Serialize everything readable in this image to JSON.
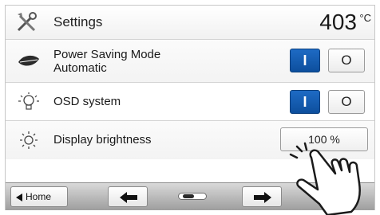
{
  "header": {
    "title": "Settings",
    "temperature": "403",
    "unit": "°C",
    "icon": "settings-tools-icon"
  },
  "rows": [
    {
      "id": "power-saving",
      "icon": "leaf-icon",
      "label_line1": "Power Saving Mode",
      "label_line2": "Automatic",
      "on_label": "I",
      "off_label": "O",
      "state": "on"
    },
    {
      "id": "osd-system",
      "icon": "bulb-icon",
      "label": "OSD system",
      "on_label": "I",
      "off_label": "O",
      "state": "on"
    },
    {
      "id": "display-brightness",
      "icon": "sun-icon",
      "label": "Display brightness",
      "value": "100 %"
    }
  ],
  "bottombar": {
    "home_label": "Home",
    "pages_total": 2,
    "page_current": 1
  },
  "colors": {
    "toggle_on": "#1563bd",
    "bar_gray": "#b5b5b5"
  }
}
